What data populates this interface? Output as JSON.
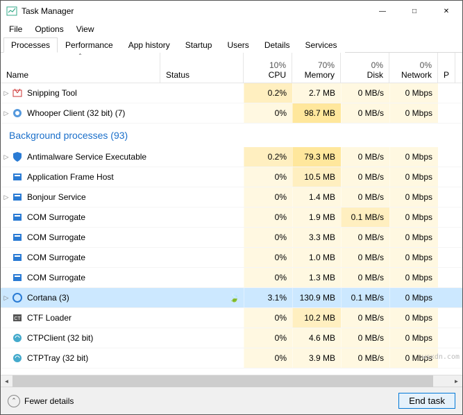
{
  "window": {
    "title": "Task Manager"
  },
  "menu": {
    "file": "File",
    "options": "Options",
    "view": "View"
  },
  "tabs": {
    "processes": "Processes",
    "performance": "Performance",
    "app_history": "App history",
    "startup": "Startup",
    "users": "Users",
    "details": "Details",
    "services": "Services"
  },
  "columns": {
    "name": "Name",
    "status": "Status",
    "cpu": {
      "pct": "10%",
      "label": "CPU"
    },
    "memory": {
      "pct": "70%",
      "label": "Memory"
    },
    "disk": {
      "pct": "0%",
      "label": "Disk"
    },
    "network": {
      "pct": "0%",
      "label": "Network"
    },
    "extra": "P"
  },
  "section": {
    "background": "Background processes (93)"
  },
  "rows": [
    {
      "icon": "snip",
      "name": "Snipping Tool",
      "expand": true,
      "cpu": "0.2%",
      "mem": "2.7 MB",
      "disk": "0 MB/s",
      "net": "0 Mbps",
      "cpu_h": 1,
      "mem_h": 0,
      "disk_h": 0,
      "net_h": 0
    },
    {
      "icon": "whoop",
      "name": "Whooper Client (32 bit) (7)",
      "expand": true,
      "cpu": "0%",
      "mem": "98.7 MB",
      "disk": "0 MB/s",
      "net": "0 Mbps",
      "cpu_h": 0,
      "mem_h": 2,
      "disk_h": 0,
      "net_h": 0
    }
  ],
  "bg_rows": [
    {
      "icon": "shield",
      "name": "Antimalware Service Executable",
      "expand": true,
      "cpu": "0.2%",
      "mem": "79.3 MB",
      "disk": "0 MB/s",
      "net": "0 Mbps",
      "cpu_h": 1,
      "mem_h": 2,
      "disk_h": 0,
      "net_h": 0
    },
    {
      "icon": "app",
      "name": "Application Frame Host",
      "expand": false,
      "cpu": "0%",
      "mem": "10.5 MB",
      "disk": "0 MB/s",
      "net": "0 Mbps",
      "cpu_h": 0,
      "mem_h": 1,
      "disk_h": 0,
      "net_h": 0
    },
    {
      "icon": "app",
      "name": "Bonjour Service",
      "expand": true,
      "cpu": "0%",
      "mem": "1.4 MB",
      "disk": "0 MB/s",
      "net": "0 Mbps",
      "cpu_h": 0,
      "mem_h": 0,
      "disk_h": 0,
      "net_h": 0
    },
    {
      "icon": "app",
      "name": "COM Surrogate",
      "expand": false,
      "cpu": "0%",
      "mem": "1.9 MB",
      "disk": "0.1 MB/s",
      "net": "0 Mbps",
      "cpu_h": 0,
      "mem_h": 0,
      "disk_h": 1,
      "net_h": 0
    },
    {
      "icon": "app",
      "name": "COM Surrogate",
      "expand": false,
      "cpu": "0%",
      "mem": "3.3 MB",
      "disk": "0 MB/s",
      "net": "0 Mbps",
      "cpu_h": 0,
      "mem_h": 0,
      "disk_h": 0,
      "net_h": 0
    },
    {
      "icon": "app",
      "name": "COM Surrogate",
      "expand": false,
      "cpu": "0%",
      "mem": "1.0 MB",
      "disk": "0 MB/s",
      "net": "0 Mbps",
      "cpu_h": 0,
      "mem_h": 0,
      "disk_h": 0,
      "net_h": 0
    },
    {
      "icon": "app",
      "name": "COM Surrogate",
      "expand": false,
      "cpu": "0%",
      "mem": "1.3 MB",
      "disk": "0 MB/s",
      "net": "0 Mbps",
      "cpu_h": 0,
      "mem_h": 0,
      "disk_h": 0,
      "net_h": 0
    },
    {
      "icon": "cortana",
      "name": "Cortana (3)",
      "expand": true,
      "selected": true,
      "leaf": true,
      "cpu": "3.1%",
      "mem": "130.9 MB",
      "disk": "0.1 MB/s",
      "net": "0 Mbps",
      "cpu_h": 2,
      "mem_h": 3,
      "disk_h": 1,
      "net_h": 0
    },
    {
      "icon": "ctf",
      "name": "CTF Loader",
      "expand": false,
      "cpu": "0%",
      "mem": "10.2 MB",
      "disk": "0 MB/s",
      "net": "0 Mbps",
      "cpu_h": 0,
      "mem_h": 1,
      "disk_h": 0,
      "net_h": 0
    },
    {
      "icon": "ctp",
      "name": "CTPClient (32 bit)",
      "expand": false,
      "cpu": "0%",
      "mem": "4.6 MB",
      "disk": "0 MB/s",
      "net": "0 Mbps",
      "cpu_h": 0,
      "mem_h": 0,
      "disk_h": 0,
      "net_h": 0
    },
    {
      "icon": "ctp",
      "name": "CTPTray (32 bit)",
      "expand": false,
      "cpu": "0%",
      "mem": "3.9 MB",
      "disk": "0 MB/s",
      "net": "0 Mbps",
      "cpu_h": 0,
      "mem_h": 0,
      "disk_h": 0,
      "net_h": 0
    }
  ],
  "footer": {
    "fewer": "Fewer details",
    "end": "End task"
  },
  "watermark": "wsxdn.com"
}
